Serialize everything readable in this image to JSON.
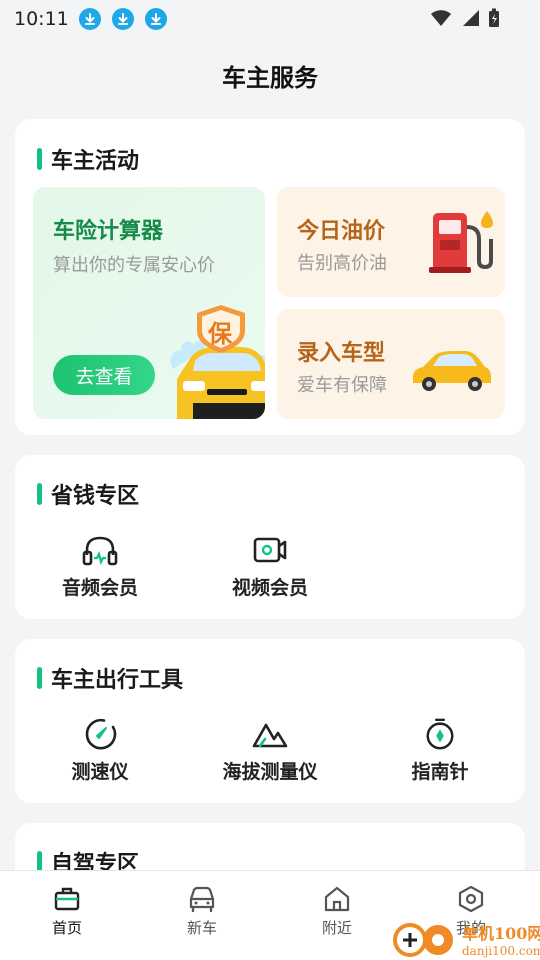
{
  "status_bar": {
    "time": "10:11"
  },
  "page": {
    "title": "车主服务"
  },
  "sections": {
    "activities": {
      "title": "车主活动",
      "big": {
        "title": "车险计算器",
        "subtitle": "算出你的专属安心价",
        "button": "去查看",
        "badge": "保"
      },
      "oil": {
        "title": "今日油价",
        "subtitle": "告别高价油"
      },
      "car_model": {
        "title": "录入车型",
        "subtitle": "爱车有保障"
      }
    },
    "savings": {
      "title": "省钱专区",
      "items": [
        {
          "label": "音频会员",
          "icon": "headphones-icon"
        },
        {
          "label": "视频会员",
          "icon": "video-icon"
        }
      ]
    },
    "tools": {
      "title": "车主出行工具",
      "items": [
        {
          "label": "测速仪",
          "icon": "speedometer-icon"
        },
        {
          "label": "海拔测量仪",
          "icon": "mountain-icon"
        },
        {
          "label": "指南针",
          "icon": "compass-icon"
        }
      ]
    },
    "self_drive": {
      "title": "自驾专区"
    }
  },
  "tabbar": {
    "tabs": [
      {
        "label": "首页",
        "icon": "home-briefcase-icon",
        "active": true
      },
      {
        "label": "新车",
        "icon": "car-icon",
        "active": false
      },
      {
        "label": "附近",
        "icon": "house-icon",
        "active": false
      },
      {
        "label": "我的",
        "icon": "hexagon-settings-icon",
        "active": false
      }
    ]
  },
  "watermark": {
    "brand": "单机100网",
    "url": "danji100.com"
  },
  "colors": {
    "accent": "#13c27e",
    "background": "#f3f4f6",
    "card": "#ffffff",
    "oil_card": "#fdf3e6",
    "insurance_card": "#e3f8e8"
  }
}
